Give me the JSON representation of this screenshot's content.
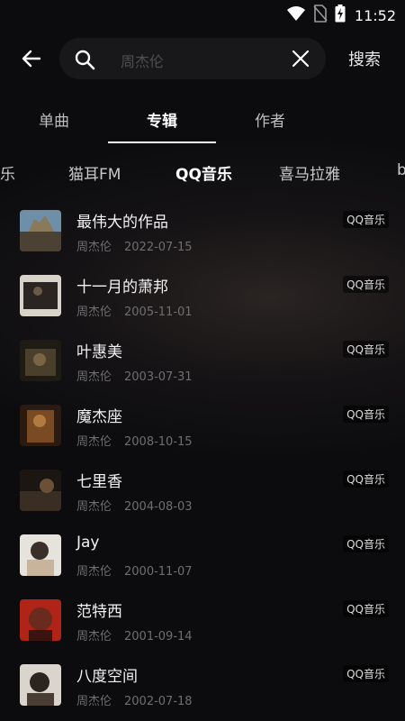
{
  "status": {
    "time": "11:52"
  },
  "search": {
    "query": "周杰伦",
    "button_label": "搜索"
  },
  "tabs": [
    {
      "label": "单曲"
    },
    {
      "label": "专辑"
    },
    {
      "label": "作者"
    }
  ],
  "sources": [
    {
      "label": "音乐"
    },
    {
      "label": "猫耳FM"
    },
    {
      "label": "QQ音乐"
    },
    {
      "label": "喜马拉雅"
    },
    {
      "label": "b"
    }
  ],
  "albums": [
    {
      "title": "最伟大的作品",
      "artist": "周杰伦",
      "date": "2022-07-15",
      "source": "QQ音乐"
    },
    {
      "title": "十一月的萧邦",
      "artist": "周杰伦",
      "date": "2005-11-01",
      "source": "QQ音乐"
    },
    {
      "title": "叶惠美",
      "artist": "周杰伦",
      "date": "2003-07-31",
      "source": "QQ音乐"
    },
    {
      "title": "魔杰座",
      "artist": "周杰伦",
      "date": "2008-10-15",
      "source": "QQ音乐"
    },
    {
      "title": "七里香",
      "artist": "周杰伦",
      "date": "2004-08-03",
      "source": "QQ音乐"
    },
    {
      "title": "Jay",
      "artist": "周杰伦",
      "date": "2000-11-07",
      "source": "QQ音乐"
    },
    {
      "title": "范特西",
      "artist": "周杰伦",
      "date": "2001-09-14",
      "source": "QQ音乐"
    },
    {
      "title": "八度空间",
      "artist": "周杰伦",
      "date": "2002-07-18",
      "source": "QQ音乐"
    }
  ],
  "colors": {
    "background": "#141214",
    "accent": "#ffffff",
    "muted": "#6e6e70"
  }
}
